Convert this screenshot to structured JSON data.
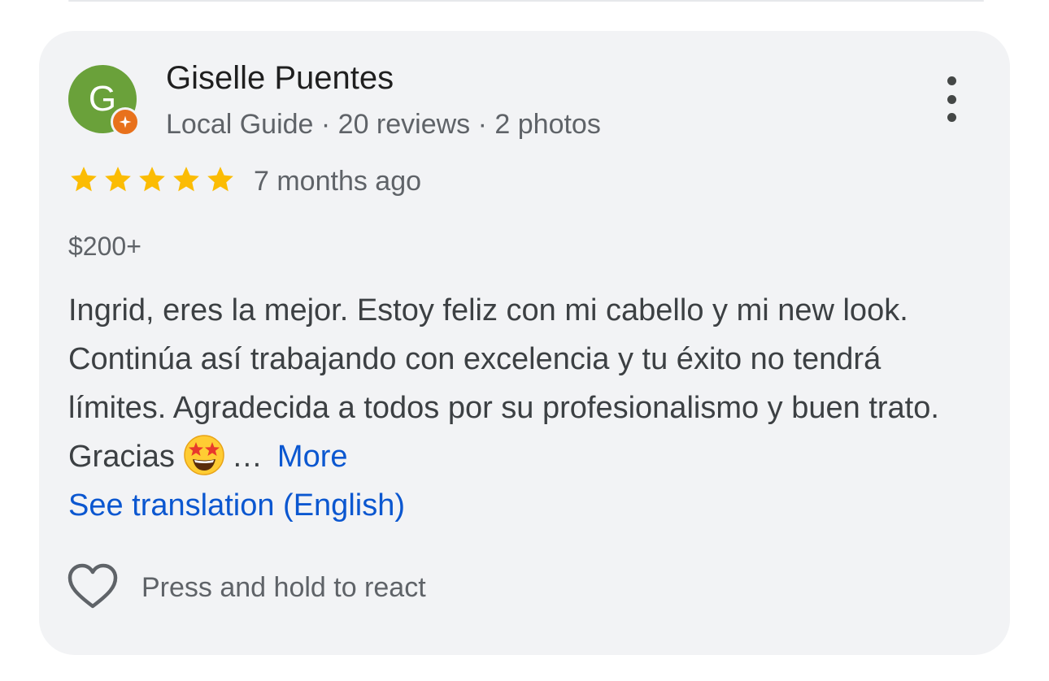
{
  "review": {
    "avatar_initial": "G",
    "name": "Giselle Puentes",
    "meta": "Local Guide · 20 reviews · 2 photos",
    "rating": 5,
    "rating_max": 5,
    "time_ago": "7 months ago",
    "price": "$200+",
    "text": "Ingrid, eres la mejor. Estoy feliz con mi cabello y mi new look. Continúa así trabajando con excelencia y tu éxito no tendrá límites. Agradecida a todos por su profesionalismo y buen trato. Gracias",
    "ellipsis": "…",
    "more_label": "More",
    "translation_label": "See translation (English)",
    "react_label": "Press and hold to react"
  },
  "icons": {
    "avatar_badge": "local-guide-badge-icon",
    "menu": "more-vert-icon",
    "star": "star-icon",
    "emoji": "star-struck-emoji",
    "react": "heart-outline-icon"
  },
  "colors": {
    "avatar_bg": "#6aa13a",
    "badge": "#e8711c",
    "star": "#fbbc04",
    "link": "#0b57d0",
    "card_bg": "#f2f3f5"
  }
}
